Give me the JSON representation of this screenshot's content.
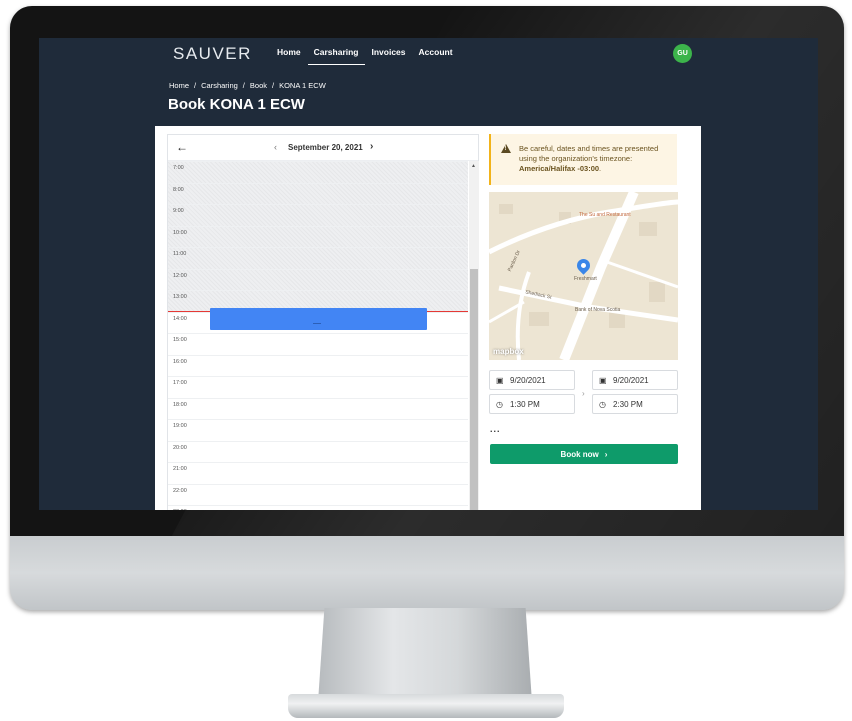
{
  "app": {
    "logo": "SAUVER"
  },
  "nav": {
    "items": [
      "Home",
      "Carsharing",
      "Invoices",
      "Account"
    ],
    "active": "Carsharing"
  },
  "user": {
    "initials": "GU"
  },
  "breadcrumb": [
    "Home",
    "Carsharing",
    "Book",
    "KONA 1 ECW"
  ],
  "page": {
    "title": "Book KONA 1 ECW"
  },
  "calendar": {
    "date": "September 20, 2021",
    "hours": [
      "7:00",
      "8:00",
      "9:00",
      "10:00",
      "11:00",
      "12:00",
      "13:00",
      "14:00",
      "15:00",
      "16:00",
      "17:00",
      "18:00",
      "19:00",
      "20:00",
      "21:00",
      "22:00",
      "23:00"
    ]
  },
  "warning": {
    "text_before": "Be careful, dates and times are presented using the organization's timezone: ",
    "timezone": "America/Halifax -03:00",
    "text_after": "."
  },
  "map": {
    "labels": {
      "restaurant": "The Su and Restaurant",
      "freshmart": "Freshmart",
      "bank": "Bank of Nova Scotia",
      "street": "Shediack St",
      "street2": "Pardon Dr"
    },
    "attribution": "mapbox"
  },
  "booking": {
    "start_date": "9/20/2021",
    "start_time": "1:30 PM",
    "end_date": "9/20/2021",
    "end_time": "2:30 PM",
    "more": "...",
    "book_label": "Book now"
  },
  "colors": {
    "header_bg": "#1f2b3a",
    "event": "#4285f4",
    "now_line": "#e53935",
    "primary_button": "#0e9b6a",
    "avatar": "#3cb44b",
    "warning_border": "#f2b31a"
  }
}
